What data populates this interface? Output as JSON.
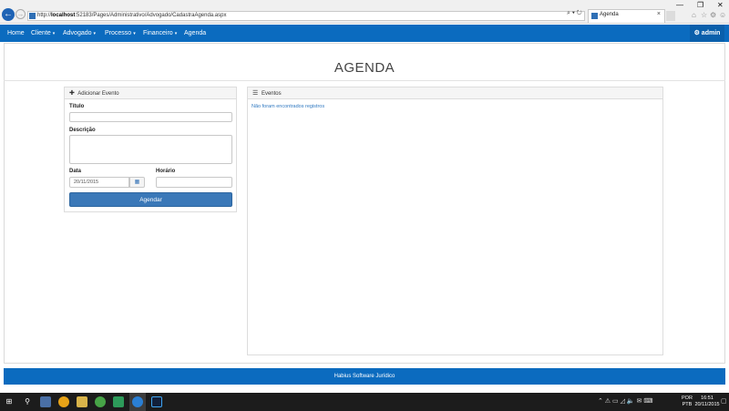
{
  "browser": {
    "url_prefix": "http://",
    "url_host": "localhost",
    "url_rest": ":52183/Pages/Administrativo/Advogado/CadastraAgenda.aspx",
    "search_refresh": "⌕ ▾ ↻",
    "tab_title": "Agenda",
    "tab_close": "×",
    "minimize": "—",
    "restore": "❐",
    "close": "✕",
    "home_icon": "⌂",
    "favorites_icon": "☆",
    "settings_icon": "⚙",
    "smiley_icon": "☺"
  },
  "nav": {
    "items": [
      {
        "label": "Home",
        "dropdown": false
      },
      {
        "label": "Cliente",
        "dropdown": true
      },
      {
        "label": "Advogado",
        "dropdown": true
      },
      {
        "label": "Processo",
        "dropdown": true
      },
      {
        "label": "Financeiro",
        "dropdown": true
      },
      {
        "label": "Agenda",
        "dropdown": false
      }
    ],
    "caret": "▾",
    "admin_icon": "⚙",
    "admin_label": "admin"
  },
  "page": {
    "title": "AGENDA"
  },
  "add_event": {
    "icon": "✚",
    "header": "Adicionar Evento",
    "titulo_label": "Título",
    "titulo_value": "",
    "descricao_label": "Descrição",
    "descricao_value": "",
    "data_label": "Data",
    "data_value": "20/11/2015",
    "calendar_icon": "▦",
    "horario_label": "Horário",
    "horario_value": "",
    "submit_label": "Agendar"
  },
  "events": {
    "icon": "☰",
    "header": "Eventos",
    "empty_message": "Não foram encontrados registros"
  },
  "footer": {
    "text": "Habius Software Jurídico"
  },
  "taskbar": {
    "start_icon": "⊞",
    "search_icon": "⚲",
    "tray_icons": "⌃ ⚠ ▭ ◿ 🔈 ✉ ⌨",
    "language_line1": "POR",
    "language_line2": "PTB",
    "time": "16:51",
    "date": "20/11/2015",
    "notification_icon": "▢"
  },
  "colors": {
    "brand_blue": "#0b6bbf",
    "button_blue": "#3a78b8",
    "link_blue": "#2f78c0"
  }
}
